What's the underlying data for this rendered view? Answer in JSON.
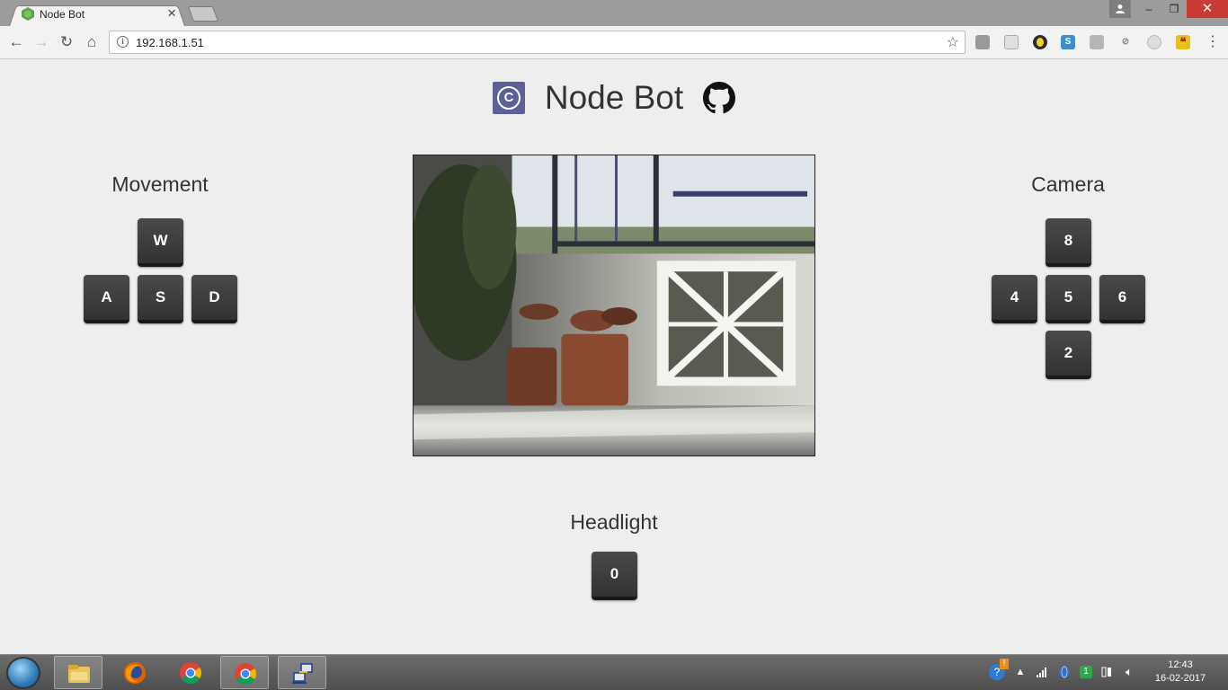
{
  "browser": {
    "tab_title": "Node Bot",
    "tab_close": "×",
    "url": "192.168.1.51",
    "window_controls": {
      "minimize": "–",
      "maximize": "❐",
      "close": "✕"
    },
    "nav": {
      "back": "←",
      "forward": "→",
      "reload": "↻",
      "home": "⌂",
      "star": "☆",
      "menu": "⋮",
      "info": "i"
    },
    "extensions": [
      "extension-icon",
      "extension-icon",
      "extension-icon",
      "s-icon",
      "extension-icon",
      "extension-icon",
      "extension-icon",
      "quote-icon"
    ]
  },
  "page": {
    "title": "Node Bot",
    "logo_letter": "C",
    "movement": {
      "title": "Movement",
      "keys": [
        "W",
        "A",
        "S",
        "D"
      ]
    },
    "camera": {
      "title": "Camera",
      "keys": [
        "8",
        "4",
        "5",
        "6",
        "2"
      ]
    },
    "headlight": {
      "title": "Headlight",
      "key": "0"
    }
  },
  "taskbar": {
    "apps": [
      "file-explorer-icon",
      "firefox-icon",
      "chrome-icon",
      "chrome-icon",
      "network-app-icon"
    ],
    "tray_up": "▲",
    "time": "12:43",
    "date": "16-02-2017"
  },
  "colors": {
    "page_bg": "#eeeeee",
    "key_bg": "#3b3b3b",
    "logo_bg": "#5c5f98",
    "close_btn": "#c93b34"
  }
}
